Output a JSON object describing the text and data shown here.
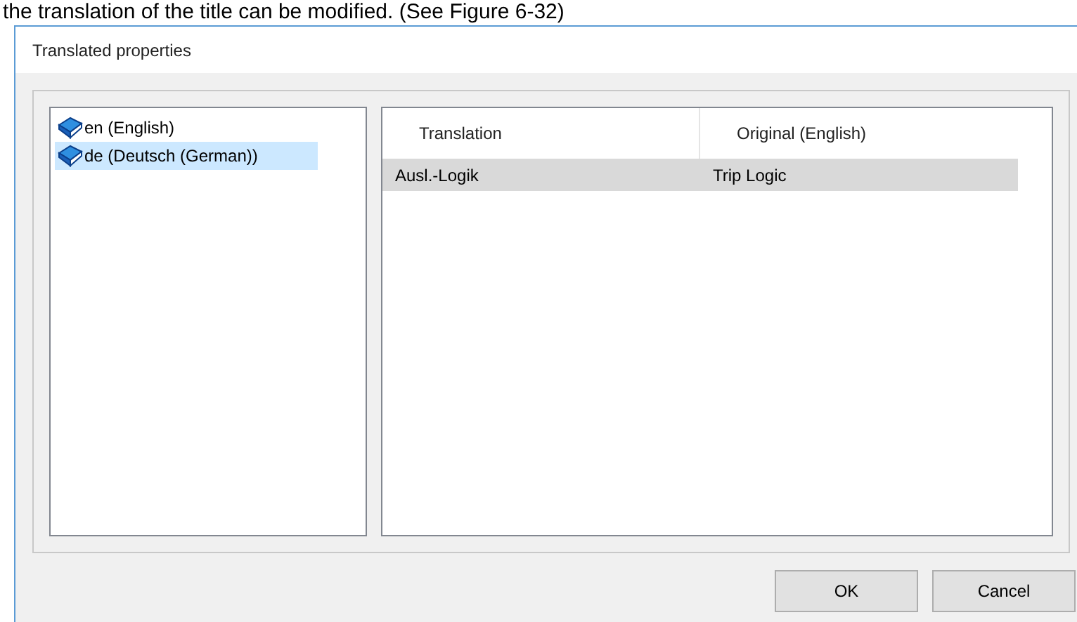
{
  "caption": "the translation of the title can be modified. (See Figure 6-32)",
  "window": {
    "title": "Translated properties"
  },
  "languages": [
    {
      "label": "en (English)",
      "selected": false
    },
    {
      "label": "de (Deutsch (German))",
      "selected": true
    }
  ],
  "table": {
    "columns": [
      "Translation",
      "Original (English)"
    ],
    "rows": [
      {
        "cells": [
          "Ausl.-Logik",
          "Trip Logic"
        ],
        "selected": true
      }
    ]
  },
  "buttons": [
    "OK",
    "Cancel"
  ]
}
